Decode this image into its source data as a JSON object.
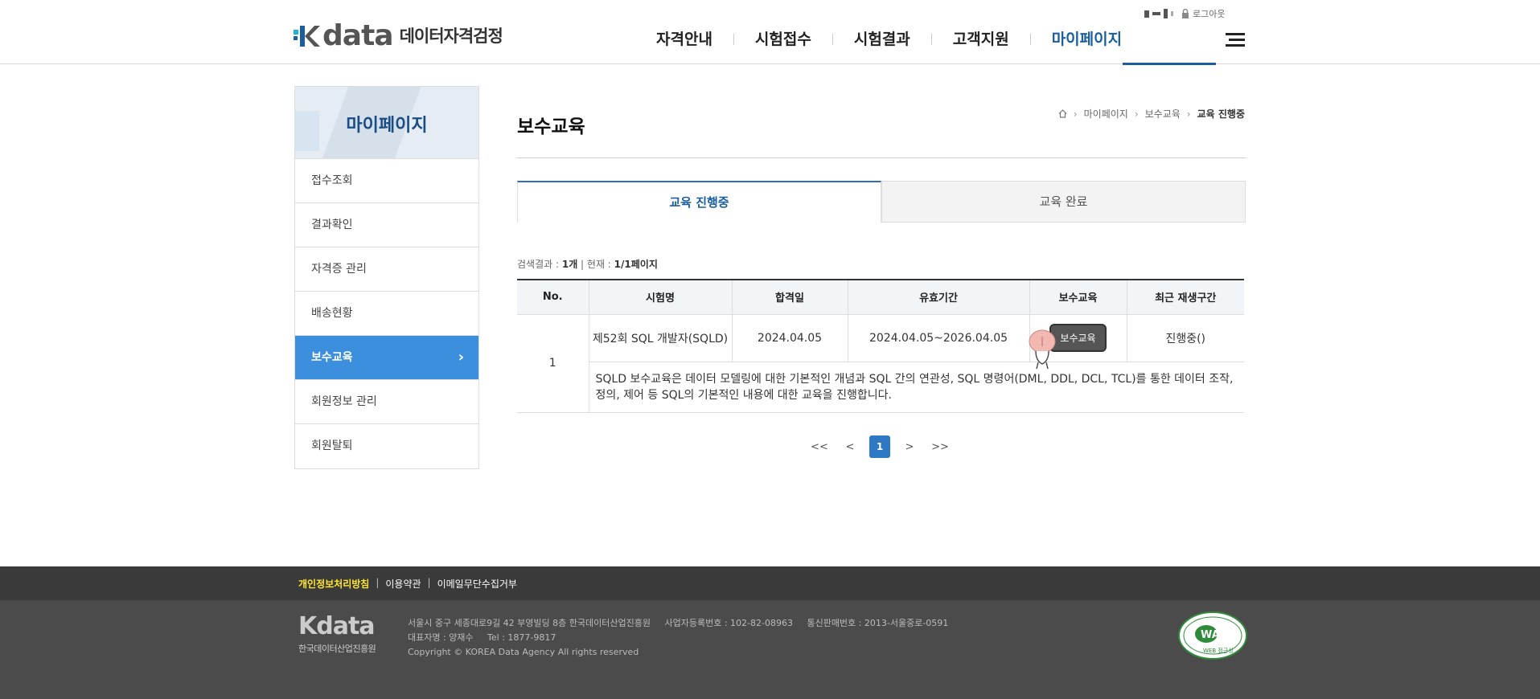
{
  "header": {
    "logo_text": "data",
    "logo_name": "데이터자격검정",
    "logout": "로그아웃",
    "nav": [
      "자격안내",
      "시험접수",
      "시험결과",
      "고객지원",
      "마이페이지"
    ]
  },
  "sidebar": {
    "title": "마이페이지",
    "items": [
      {
        "label": "접수조회"
      },
      {
        "label": "결과확인"
      },
      {
        "label": "자격증 관리"
      },
      {
        "label": "배송현황"
      },
      {
        "label": "보수교육",
        "active": true
      },
      {
        "label": "회원정보 관리"
      },
      {
        "label": "회원탈퇴"
      }
    ]
  },
  "main": {
    "page_title": "보수교육",
    "breadcrumb": [
      "마이페이지",
      "보수교육",
      "교육 진행중"
    ],
    "tabs": [
      {
        "label": "교육 진행중",
        "active": true
      },
      {
        "label": "교육 완료"
      }
    ],
    "result": {
      "label": "검색결과 : ",
      "count": "1개",
      "divider": " | 현재 : ",
      "page": "1/1페이지"
    },
    "table": {
      "columns": [
        "No.",
        "시험명",
        "합격일",
        "유효기간",
        "보수교육",
        "최근 재생구간"
      ],
      "rows": [
        {
          "no": "1",
          "exam": "제52회 SQL 개발자(SQLD)",
          "pass_date": "2024.04.05",
          "valid": "2024.04.05~2026.04.05",
          "button": "보수교육",
          "recent": "진행중()",
          "description": "SQLD 보수교육은 데이터 모델링에 대한 기본적인 개념과 SQL 간의 연관성, SQL 명령어(DML, DDL, DCL, TCL)를 통한 데이터 조작, 정의, 제어 등 SQL의 기본적인 내용에 대한 교육을 진행합니다."
        }
      ]
    },
    "pagination": {
      "first": "<<",
      "prev": "<",
      "current": "1",
      "next": ">",
      "last": ">>"
    }
  },
  "footer": {
    "links": [
      "개인정보처리방침",
      "이용약관",
      "이메일무단수집거부"
    ],
    "logo_text": "data",
    "logo_name": "한국데이터산업진흥원",
    "address": "서울시 중구 세종대로9길 42 부영빌딩 8층 한국데이터산업진흥원",
    "bizno": "사업자등록번호 : 102-82-08963",
    "mailorder": "통신판매번호 : 2013-서울중로-0591",
    "ceo": "대표자명 : 양재수",
    "tel": "Tel : 1877-9817",
    "copyright": "Copyright © KOREA Data Agency All rights reserved",
    "badge_text": "WA",
    "badge_sub": "WEB 접근성"
  },
  "colors": {
    "accent": "#1a5ea0",
    "sidebar_active": "#3c8fdd",
    "page_current": "#2f79c4",
    "footer_top": "#3a3a3a",
    "footer_bottom": "#4b4b4b",
    "privacy_link": "#ffe530",
    "logo_cyan": "#1cb5d8",
    "logo_blue": "#1a5ea0"
  }
}
